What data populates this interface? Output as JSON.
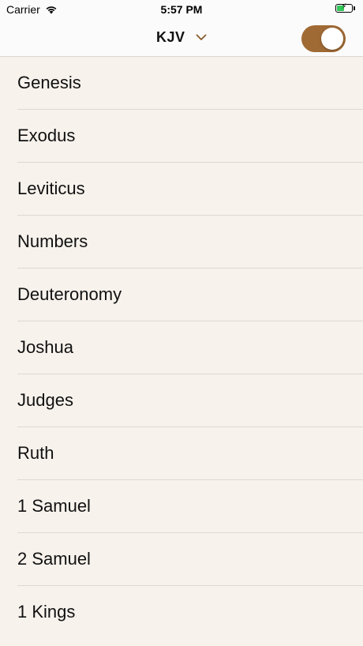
{
  "status_bar": {
    "carrier": "Carrier",
    "time": "5:57 PM",
    "battery_level": 0.5,
    "battery_color": "#34c759"
  },
  "nav": {
    "title": "KJV",
    "dropdown_icon": "chevron-down-icon",
    "toggle_on": true,
    "toggle_color": "#a06a34"
  },
  "books": [
    {
      "name": "Genesis"
    },
    {
      "name": "Exodus"
    },
    {
      "name": "Leviticus"
    },
    {
      "name": "Numbers"
    },
    {
      "name": "Deuteronomy"
    },
    {
      "name": "Joshua"
    },
    {
      "name": "Judges"
    },
    {
      "name": "Ruth"
    },
    {
      "name": "1 Samuel"
    },
    {
      "name": "2 Samuel"
    },
    {
      "name": "1 Kings"
    }
  ]
}
